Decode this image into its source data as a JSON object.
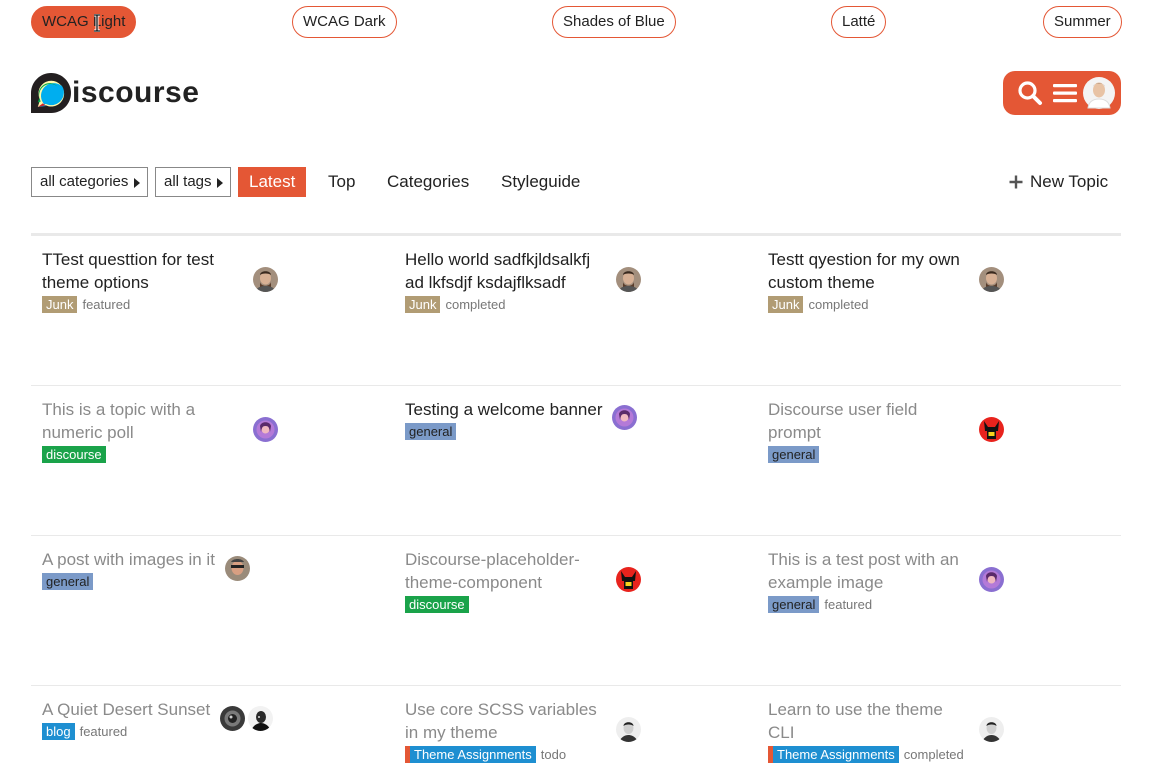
{
  "theme_pills": [
    {
      "label": "WCAG Light",
      "active": true
    },
    {
      "label": "WCAG Dark",
      "active": false
    },
    {
      "label": "Shades of Blue",
      "active": false
    },
    {
      "label": "Latté",
      "active": false
    },
    {
      "label": "Summer",
      "active": false
    }
  ],
  "brand": {
    "logo_text": "iscourse",
    "accent": "#e45735"
  },
  "header": {
    "icons": [
      "search-icon",
      "hamburger-menu-icon",
      "user-avatar"
    ]
  },
  "nav": {
    "categories_dropdown": "all categories",
    "tags_dropdown": "all tags",
    "tabs": [
      "Latest",
      "Top",
      "Categories",
      "Styleguide"
    ],
    "active_tab": "Latest",
    "new_topic": "New Topic"
  },
  "topics": [
    {
      "title": "TTest questtion for test theme options",
      "category": "Junk",
      "category_color": "#b19c74",
      "tag": "featured",
      "visited": false
    },
    {
      "title": "Hello world sadfkjldsalkfj ad lkfsdjf ksdajflksadf",
      "category": "Junk",
      "category_color": "#b19c74",
      "tag": "completed",
      "visited": false
    },
    {
      "title": "Testt qyestion for my own custom theme",
      "category": "Junk",
      "category_color": "#b19c74",
      "tag": "completed",
      "visited": false
    },
    {
      "title": "This is a topic with a numeric poll",
      "category": "discourse",
      "category_color": "#1aa34a",
      "tag": "",
      "visited": true
    },
    {
      "title": "Testing a welcome banner",
      "category": "general",
      "category_color": "#7b9ac8",
      "tag": "",
      "visited": false
    },
    {
      "title": "Discourse user field prompt",
      "category": "general",
      "category_color": "#7b9ac8",
      "tag": "",
      "visited": true
    },
    {
      "title": "A post with images in it",
      "category": "general",
      "category_color": "#7b9ac8",
      "tag": "",
      "visited": true
    },
    {
      "title": "Discourse-placeholder-theme-component",
      "category": "discourse",
      "category_color": "#1aa34a",
      "tag": "",
      "visited": true
    },
    {
      "title": "This is a test post with an example image",
      "category": "general",
      "category_color": "#7b9ac8",
      "tag": "featured",
      "visited": true
    },
    {
      "title": "A Quiet Desert Sunset",
      "category": "blog",
      "category_color": "#1e8fd1",
      "tag": "featured",
      "visited": true
    },
    {
      "title": "Use core SCSS variables in my theme",
      "category": "Theme Assignments",
      "category_color": "#1e8fd1",
      "stripe_color": "#e45735",
      "tag": "todo",
      "visited": true
    },
    {
      "title": "Learn to use the theme CLI",
      "category": "Theme Assignments",
      "category_color": "#1e8fd1",
      "stripe_color": "#e45735",
      "tag": "completed",
      "visited": true
    }
  ]
}
